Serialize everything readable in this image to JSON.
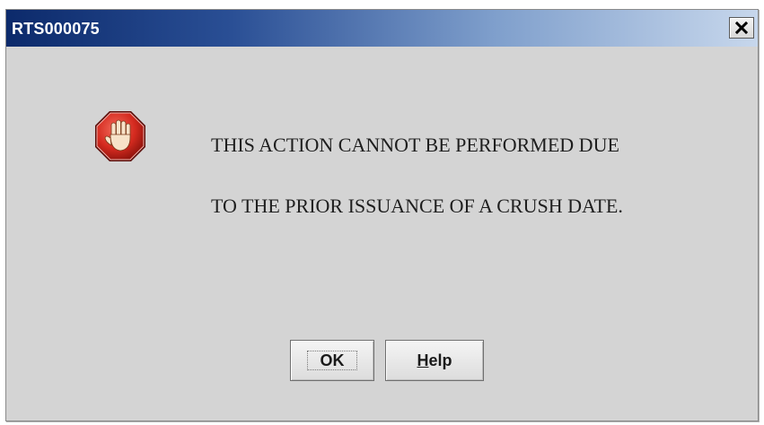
{
  "dialog": {
    "title": "RTS000075",
    "close_label": "×",
    "message_line1": "THIS ACTION CANNOT BE PERFORMED DUE",
    "message_line2": "TO THE PRIOR ISSUANCE OF A CRUSH DATE.",
    "icon": "stop-hand-icon"
  },
  "buttons": {
    "ok_label": "OK",
    "help_mnemonic": "H",
    "help_rest": "elp"
  },
  "colors": {
    "title_bar_start": "#0c2a6b",
    "title_bar_end": "#c7d7ec",
    "dialog_background": "#d4d4d4",
    "stop_icon_red": "#d42a1f"
  }
}
